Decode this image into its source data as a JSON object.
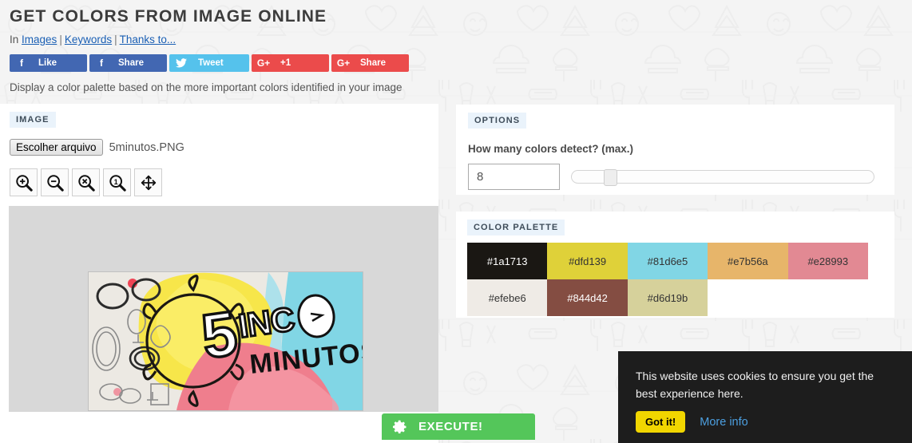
{
  "header": {
    "title": "GET COLORS FROM IMAGE ONLINE",
    "breadcrumb_prefix": "In",
    "breadcrumb_links": [
      "Images",
      "Keywords",
      "Thanks to..."
    ],
    "breadcrumb_separator": "|",
    "subtitle": "Display a color palette based on the more important colors identified in your image"
  },
  "social": [
    {
      "label": "Like",
      "icon": "facebook-icon",
      "glyph": "f",
      "color": "#4267b2"
    },
    {
      "label": "Share",
      "icon": "facebook-icon",
      "glyph": "f",
      "color": "#4267b2"
    },
    {
      "label": "Tweet",
      "icon": "twitter-bird-icon",
      "glyph": "🕊",
      "color": "#55c2ec"
    },
    {
      "label": "+1",
      "icon": "google-plus-icon",
      "glyph": "G+",
      "color": "#eb4b4b"
    },
    {
      "label": "Share",
      "icon": "google-plus-icon",
      "glyph": "G+",
      "color": "#eb4b4b"
    }
  ],
  "image_panel": {
    "badge": "IMAGE",
    "file_button_label": "Escolher arquivo",
    "file_name": "5minutos.PNG",
    "tools": [
      {
        "name": "zoom-in-icon",
        "symbol": "+"
      },
      {
        "name": "zoom-out-icon",
        "symbol": "−"
      },
      {
        "name": "zoom-reset-icon",
        "symbol": "×"
      },
      {
        "name": "zoom-actual-size-icon",
        "symbol": "1"
      },
      {
        "name": "move-icon",
        "symbol": "✛"
      }
    ],
    "preview_alt": "5inco MINUTOS watercolor banner"
  },
  "options": {
    "badge": "OPTIONS",
    "question": "How many colors detect? (max.)",
    "colors_value": "8",
    "slider_percent": 11
  },
  "palette": {
    "badge": "COLOR PALETTE",
    "swatches": [
      {
        "hex": "#1a1713",
        "text_color": "#ffffff"
      },
      {
        "hex": "#dfd139",
        "text_color": "#333333"
      },
      {
        "hex": "#81d6e5",
        "text_color": "#333333"
      },
      {
        "hex": "#e7b56a",
        "text_color": "#333333"
      },
      {
        "hex": "#e28993",
        "text_color": "#333333"
      },
      {
        "hex": "#efebe6",
        "text_color": "#333333"
      },
      {
        "hex": "#844d42",
        "text_color": "#ffffff"
      },
      {
        "hex": "#d6d19b",
        "text_color": "#333333"
      }
    ]
  },
  "execute": {
    "label": "EXECUTE!",
    "icon": "gear-icon",
    "color": "#54c65a"
  },
  "cookie": {
    "message": "This website uses cookies to ensure you get the best experience here.",
    "accept_label": "Got it!",
    "more_label": "More info",
    "accept_color": "#f1d600"
  }
}
